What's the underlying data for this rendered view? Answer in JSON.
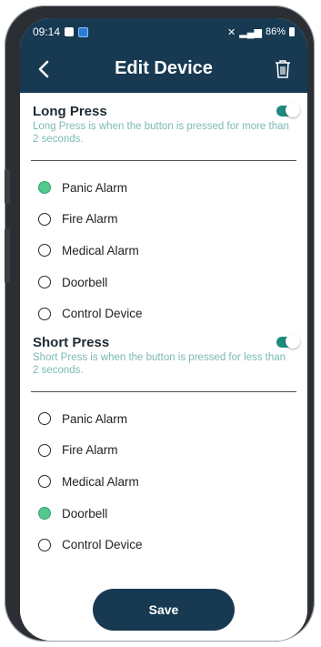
{
  "status_bar": {
    "time": "09:14",
    "battery": "86%"
  },
  "app_bar": {
    "back_icon": "chevron-left-icon",
    "title": "Edit Device",
    "delete_icon": "trash-icon"
  },
  "long_press": {
    "title": "Long Press",
    "description": "Long Press is when the button is pressed for more than 2 seconds.",
    "enabled": true,
    "options": [
      {
        "label": "Panic Alarm",
        "selected": true
      },
      {
        "label": "Fire Alarm",
        "selected": false
      },
      {
        "label": "Medical Alarm",
        "selected": false
      },
      {
        "label": "Doorbell",
        "selected": false
      },
      {
        "label": "Control Device",
        "selected": false
      }
    ]
  },
  "short_press": {
    "title": "Short Press",
    "description": "Short Press is when the button is pressed for less than 2 seconds.",
    "enabled": true,
    "options": [
      {
        "label": "Panic Alarm",
        "selected": false
      },
      {
        "label": "Fire Alarm",
        "selected": false
      },
      {
        "label": "Medical Alarm",
        "selected": false
      },
      {
        "label": "Doorbell",
        "selected": true
      },
      {
        "label": "Control Device",
        "selected": false
      }
    ]
  },
  "save_label": "Save",
  "colors": {
    "header": "#173a52",
    "accent": "#53c88f",
    "toggle": "#1e8a7e",
    "description": "#7bbab2"
  }
}
